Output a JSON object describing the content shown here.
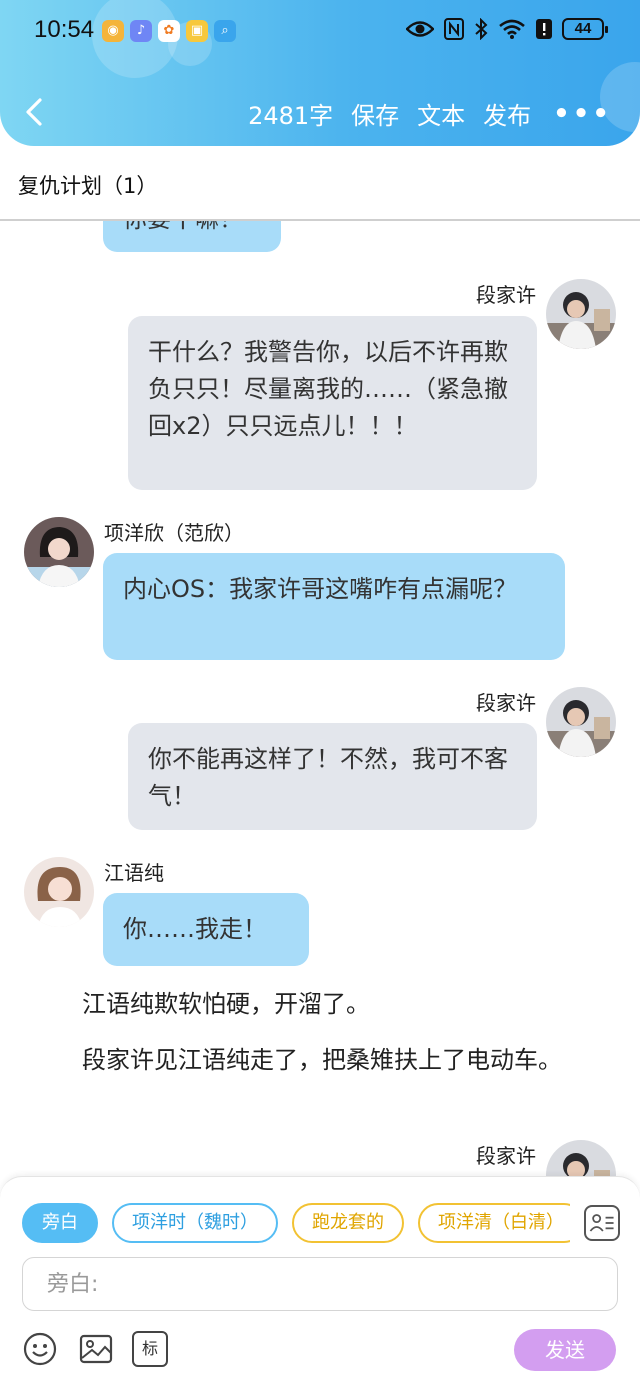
{
  "status_bar": {
    "time": "10:54",
    "battery": "44"
  },
  "header": {
    "word_count": "2481字",
    "save_label": "保存",
    "text_label": "文本",
    "publish_label": "发布",
    "more_label": "•••"
  },
  "document": {
    "title": "复仇计划（1）"
  },
  "chat": {
    "partial_top_text": "你要干嘛！",
    "messages": [
      {
        "speaker": "段家许",
        "text": "干什么？我警告你，以后不许再欺负只只！尽量离我的……（紧急撤回x2）只只远点儿！！！"
      },
      {
        "speaker": "项洋欣（范欣）",
        "text": "内心OS：我家许哥这嘴咋有点漏呢？"
      },
      {
        "speaker": "段家许",
        "text": "你不能再这样了！不然，我可不客气！"
      },
      {
        "speaker": "江语纯",
        "text": "你……我走！"
      },
      {
        "speaker": "段家许"
      }
    ],
    "narration": [
      "江语纯欺软怕硬，开溜了。",
      "段家许见江语纯走了，把桑雉扶上了电动车。"
    ]
  },
  "composer": {
    "chips": [
      "旁白",
      "项洋时（魏时）",
      "跑龙套的",
      "项洋清（白清）"
    ],
    "input_placeholder": "旁白:",
    "tag_label": "标",
    "send_label": "发送"
  },
  "colors": {
    "header_gradient_start": "#7fd6f3",
    "header_gradient_end": "#3aa5ec",
    "left_bubble": "#a8dcf9",
    "right_bubble": "#e3e6ec",
    "send_button": "#d39ef0",
    "chip_blue": "#55bdf4",
    "chip_yellow": "#f2c233"
  }
}
